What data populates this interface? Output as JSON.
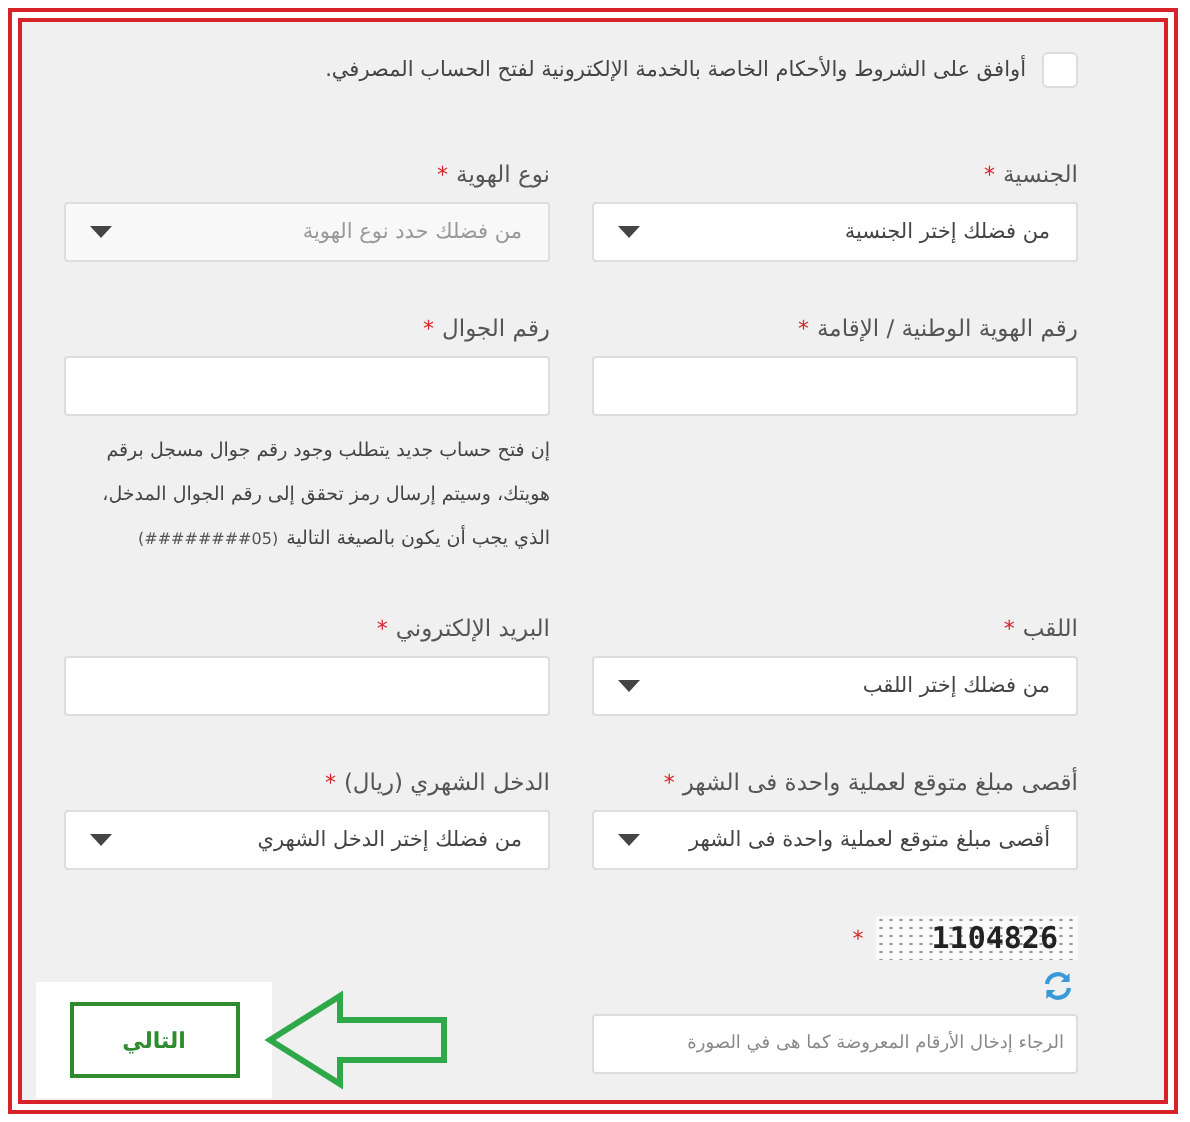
{
  "terms": {
    "label": "أوافق على الشروط والأحكام الخاصة بالخدمة الإلكترونية لفتح الحساب المصرفي.",
    "checked": false
  },
  "fields": [
    {
      "kind": "select",
      "label": "الجنسية",
      "required_mark": "*",
      "placeholder": "من فضلك إختر الجنسية",
      "muted": false
    },
    {
      "kind": "select",
      "label": "نوع الهوية",
      "required_mark": "*",
      "placeholder": "من فضلك حدد نوع الهوية",
      "muted": true
    },
    {
      "kind": "input",
      "label": "رقم الهوية الوطنية / الإقامة",
      "required_mark": "*"
    },
    {
      "kind": "input",
      "label": "رقم الجوال",
      "required_mark": "*",
      "hint": "إن فتح حساب جديد يتطلب وجود رقم جوال مسجل برقم هويتك، وسيتم إرسال رمز تحقق إلى رقم الجوال المدخل، الذي يجب أن يكون بالصيغة التالية",
      "hint_format": "(05########)"
    },
    {
      "kind": "select",
      "label": "اللقب",
      "required_mark": "*",
      "placeholder": "من فضلك إختر اللقب",
      "muted": false
    },
    {
      "kind": "input",
      "label": "البريد الإلكتروني",
      "required_mark": "*"
    },
    {
      "kind": "select",
      "label": "أقصى مبلغ متوقع لعملية واحدة فى الشهر",
      "required_mark": "*",
      "placeholder": "أقصى مبلغ متوقع لعملية واحدة فى الشهر",
      "muted": false
    },
    {
      "kind": "select",
      "label": "الدخل الشهري (ريال)",
      "required_mark": "*",
      "placeholder": "من فضلك إختر الدخل الشهري",
      "muted": false
    }
  ],
  "captcha": {
    "code": "1104826",
    "required_mark": "*",
    "placeholder": "الرجاء إدخال الأرقام المعروضة كما هى في الصورة"
  },
  "next_button": {
    "label": "التالي"
  }
}
